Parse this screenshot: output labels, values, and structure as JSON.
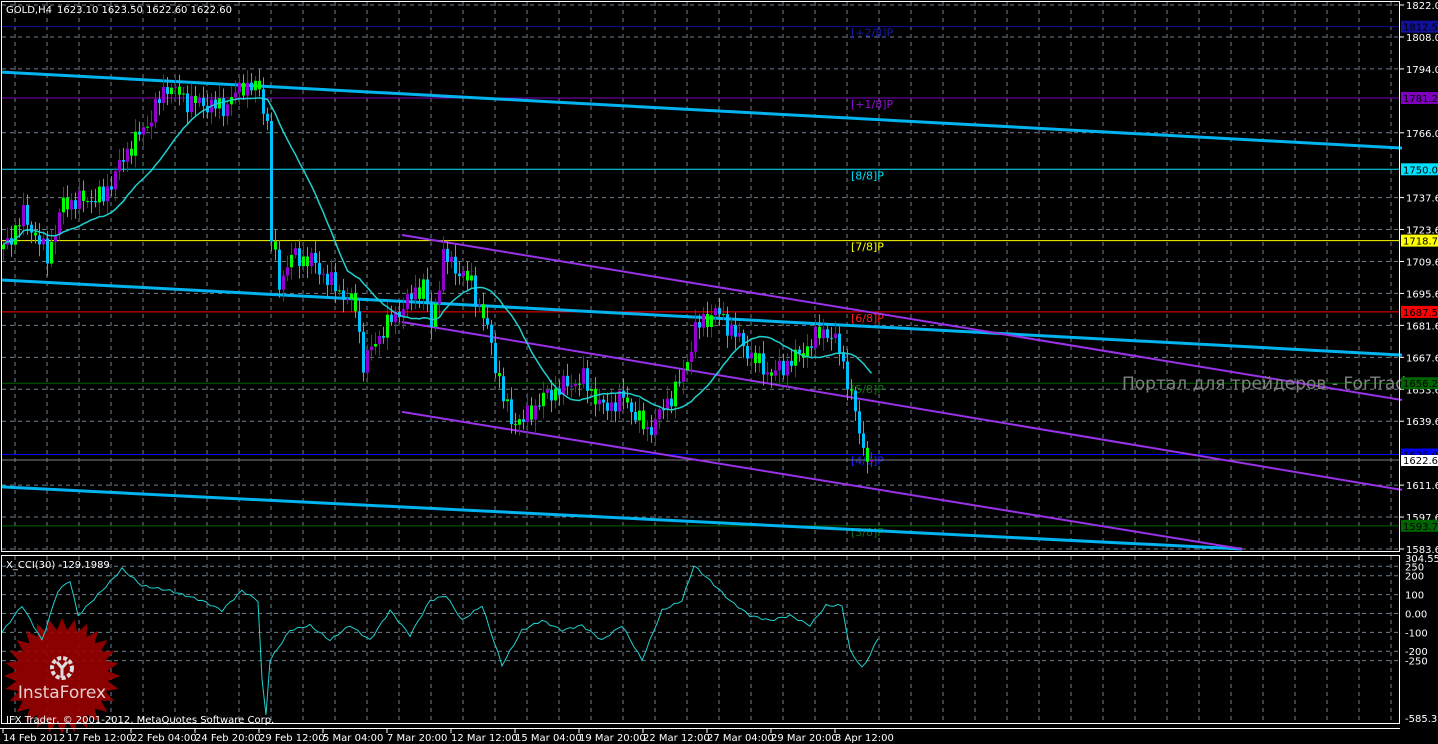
{
  "header": {
    "symbol": "GOLD,H4",
    "ohlc": "1623.10 1623.50 1622.60 1622.60"
  },
  "indicator_header": "X_CCI(30) -129.1989",
  "watermark": "Портал для трейдеров - ForTrader.ru",
  "copyright": "IFX Trader, © 2001-2012, MetaQuotes Software Corp.",
  "logo": {
    "text": "InstaForex"
  },
  "colors": {
    "background": "#000000",
    "grid": "#708090",
    "bull": "#9400d3",
    "bear": "#00bfff",
    "ma": "#20d0d0",
    "channel": "#00b4f0",
    "channel2": "#9932e8",
    "cci": "#20d0d0"
  },
  "chart_data": [
    {
      "type": "candlestick",
      "title": "GOLD,H4",
      "ylim": [
        1583.6,
        1822.0
      ],
      "price_ticks": [
        "1822.00",
        "1808.00",
        "1794.00",
        "1766.00",
        "1737.60",
        "1723.60",
        "1709.60",
        "1695.60",
        "1681.60",
        "1667.60",
        "1653.60",
        "1639.60",
        "1611.60",
        "1597.60",
        "1583.60"
      ],
      "time_labels": [
        "14 Feb 2012",
        "17 Feb 12:00",
        "22 Feb 04:00",
        "24 Feb 20:00",
        "29 Feb 12:00",
        "5 Mar 04:00",
        "7 Mar 20:00",
        "12 Mar 12:00",
        "15 Mar 04:00",
        "19 Mar 20:00",
        "22 Mar 12:00",
        "27 Mar 04:00",
        "29 Mar 20:00",
        "3 Apr 12:00"
      ],
      "bars_per_time_label": 16,
      "close_path": [
        [
          0,
          1715
        ],
        [
          5,
          1730
        ],
        [
          11,
          1712
        ],
        [
          15,
          1735
        ],
        [
          25,
          1738
        ],
        [
          31,
          1758
        ],
        [
          36,
          1770
        ],
        [
          41,
          1787
        ],
        [
          46,
          1780
        ],
        [
          55,
          1777
        ],
        [
          60,
          1787
        ],
        [
          64,
          1785
        ],
        [
          66,
          1770
        ],
        [
          67,
          1720
        ],
        [
          69,
          1700
        ],
        [
          72,
          1712
        ],
        [
          77,
          1710
        ],
        [
          82,
          1700
        ],
        [
          88,
          1690
        ],
        [
          90,
          1665
        ],
        [
          95,
          1680
        ],
        [
          100,
          1690
        ],
        [
          105,
          1700
        ],
        [
          107,
          1680
        ],
        [
          110,
          1712
        ],
        [
          117,
          1700
        ],
        [
          121,
          1680
        ],
        [
          125,
          1650
        ],
        [
          127,
          1640
        ],
        [
          130,
          1640
        ],
        [
          135,
          1650
        ],
        [
          140,
          1655
        ],
        [
          145,
          1658
        ],
        [
          150,
          1645
        ],
        [
          155,
          1650
        ],
        [
          161,
          1635
        ],
        [
          165,
          1645
        ],
        [
          170,
          1660
        ],
        [
          173,
          1680
        ],
        [
          178,
          1688
        ],
        [
          182,
          1680
        ],
        [
          187,
          1668
        ],
        [
          192,
          1660
        ],
        [
          200,
          1670
        ],
        [
          205,
          1680
        ],
        [
          209,
          1672
        ],
        [
          212,
          1650
        ],
        [
          215,
          1628
        ],
        [
          217,
          1622.6
        ]
      ],
      "moving_average_period": 20,
      "levels": [
        {
          "label": "[+2/8]P",
          "value": 1812.5,
          "price_text": "1812.50",
          "color": "#10109a",
          "text_color": "#1818b0"
        },
        {
          "label": "[+1/8]P",
          "value": 1781.25,
          "price_text": "1781.25",
          "color": "#8000c0",
          "text_color": "#9010d0"
        },
        {
          "label": "[8/8]P",
          "value": 1750.0,
          "price_text": "1750.00",
          "color": "#00e0ff",
          "text_color": "#00e0ff"
        },
        {
          "label": "[7/8]P",
          "value": 1718.75,
          "price_text": "1718.75",
          "color": "#ffff00",
          "text_color": "#ffff00"
        },
        {
          "label": "[6/8]P",
          "value": 1687.5,
          "price_text": "1687.50",
          "color": "#ff0000",
          "text_color": "#ff2020"
        },
        {
          "label": "[5/8]P",
          "value": 1656.25,
          "price_text": "1656.25",
          "color": "#006400",
          "text_color": "#107010"
        },
        {
          "label": "[4/8]P",
          "value": 1625.0,
          "price_text": "1625.00",
          "color": "#0000ff",
          "text_color": "#2020ff"
        },
        {
          "label": "[3/8]P",
          "value": 1593.75,
          "price_text": "1593.75",
          "color": "#006400",
          "text_color": "#107010"
        }
      ],
      "current_price": {
        "value": 1622.6,
        "text": "1622.60"
      },
      "trend_lines": [
        {
          "name": "channel-upper",
          "color": "#00b4f0",
          "width": 3,
          "from": [
            0,
            1792.6
          ],
          "to": [
            350,
            1759.3
          ]
        },
        {
          "name": "channel-middle",
          "color": "#00b4f0",
          "width": 3,
          "from": [
            0,
            1701.5
          ],
          "to": [
            350,
            1668.6
          ]
        },
        {
          "name": "channel-lower",
          "color": "#00b4f0",
          "width": 3,
          "from": [
            0,
            1610.8
          ],
          "to": [
            310,
            1583.6
          ]
        },
        {
          "name": "purple-upper",
          "color": "#9932e8",
          "width": 2,
          "from": [
            100,
            1721.2
          ],
          "to": [
            350,
            1648.9
          ]
        },
        {
          "name": "purple-middle",
          "color": "#9932e8",
          "width": 2,
          "from": [
            100,
            1683.1
          ],
          "to": [
            350,
            1609.5
          ]
        },
        {
          "name": "purple-lower",
          "color": "#9932e8",
          "width": 2,
          "from": [
            100,
            1643.7
          ],
          "to": [
            310,
            1583.6
          ]
        }
      ]
    },
    {
      "type": "line",
      "title": "X_CCI(30)",
      "ylim": [
        -585.3969,
        304.5542
      ],
      "tick_labels": [
        {
          "v": 250,
          "t": "250"
        },
        {
          "v": 200,
          "t": "200"
        },
        {
          "v": 100,
          "t": "100"
        },
        {
          "v": 0,
          "t": "0.00"
        },
        {
          "v": -100,
          "t": "-100"
        },
        {
          "v": -200,
          "t": "-200"
        },
        {
          "v": -250,
          "t": "-250"
        }
      ],
      "max_label": "304.5542",
      "min_label": "-585.3969",
      "path": [
        [
          0,
          -100
        ],
        [
          5,
          42
        ],
        [
          10,
          -142
        ],
        [
          14,
          121
        ],
        [
          17,
          174
        ],
        [
          19,
          -11
        ],
        [
          25,
          121
        ],
        [
          30,
          237
        ],
        [
          35,
          147
        ],
        [
          42,
          121
        ],
        [
          50,
          68
        ],
        [
          55,
          16
        ],
        [
          60,
          121
        ],
        [
          64,
          68
        ],
        [
          65,
          -353
        ],
        [
          66,
          -537
        ],
        [
          67,
          -247
        ],
        [
          72,
          -89
        ],
        [
          77,
          -63
        ],
        [
          82,
          -142
        ],
        [
          87,
          -63
        ],
        [
          92,
          -142
        ],
        [
          97,
          16
        ],
        [
          102,
          -116
        ],
        [
          107,
          68
        ],
        [
          111,
          95
        ],
        [
          115,
          -37
        ],
        [
          120,
          42
        ],
        [
          125,
          -274
        ],
        [
          130,
          -89
        ],
        [
          135,
          -37
        ],
        [
          140,
          -89
        ],
        [
          145,
          -63
        ],
        [
          150,
          -142
        ],
        [
          155,
          -63
        ],
        [
          160,
          -247
        ],
        [
          165,
          16
        ],
        [
          170,
          68
        ],
        [
          173,
          253
        ],
        [
          177,
          174
        ],
        [
          182,
          68
        ],
        [
          187,
          -11
        ],
        [
          192,
          -37
        ],
        [
          197,
          -11
        ],
        [
          202,
          -63
        ],
        [
          206,
          42
        ],
        [
          210,
          42
        ],
        [
          212,
          -195
        ],
        [
          215,
          -289
        ],
        [
          217,
          -221
        ],
        [
          219,
          -129.2
        ]
      ]
    }
  ]
}
